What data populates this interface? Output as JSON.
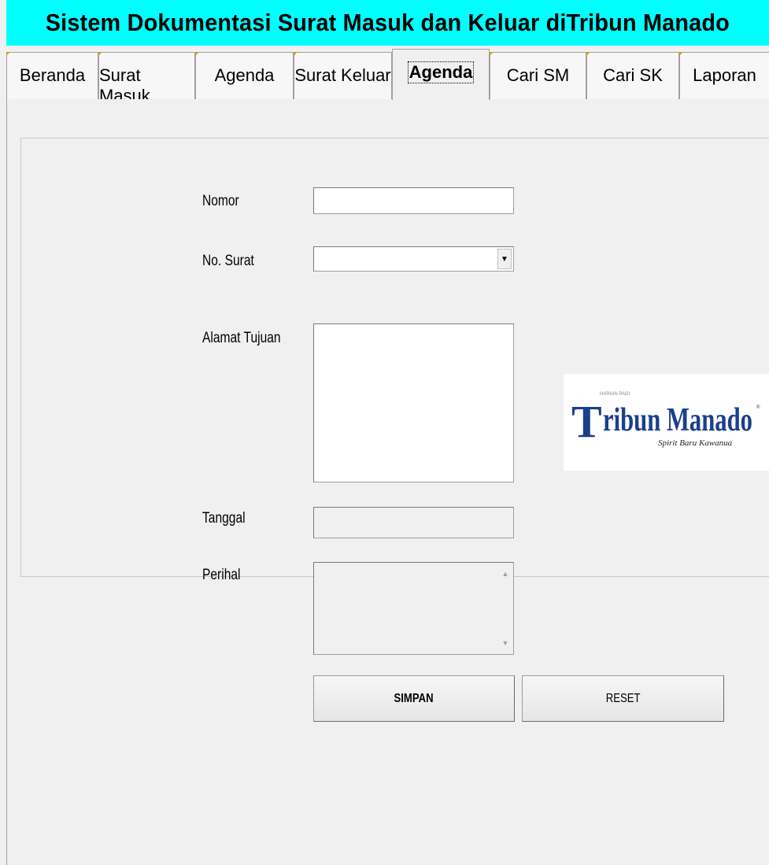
{
  "window": {
    "title": "Sistem Dokumentasi Surat Masuk dan Keluar diTribun Manado"
  },
  "tabs": [
    {
      "label": "Beranda",
      "active": false
    },
    {
      "label": "Surat Masuk",
      "active": false
    },
    {
      "label": "Agenda",
      "active": false
    },
    {
      "label": "Surat Keluar",
      "active": false
    },
    {
      "label": "Agenda",
      "active": true
    },
    {
      "label": "Cari SM",
      "active": false
    },
    {
      "label": "Cari SK",
      "active": false
    },
    {
      "label": "Laporan",
      "active": false
    }
  ],
  "form": {
    "nomor_label": "Nomor",
    "nomor_value": "",
    "no_surat_label": "No. Surat",
    "no_surat_value": "",
    "alamat_label": "Alamat Tujuan",
    "alamat_value": "",
    "tanggal_label": "Tanggal",
    "tanggal_value": "",
    "perihal_label": "Perihal",
    "perihal_value": ""
  },
  "buttons": {
    "save_label": "SIMPAN",
    "reset_label": "RESET"
  },
  "logo": {
    "brand": "Tribun Manado",
    "tagline": "Spirit Baru Kawanua",
    "small_text": "HARIAN PAGI",
    "color": "#1a3f8c"
  },
  "colors": {
    "title_bg": "#00ffff",
    "window_bg": "#f0f0f0"
  }
}
